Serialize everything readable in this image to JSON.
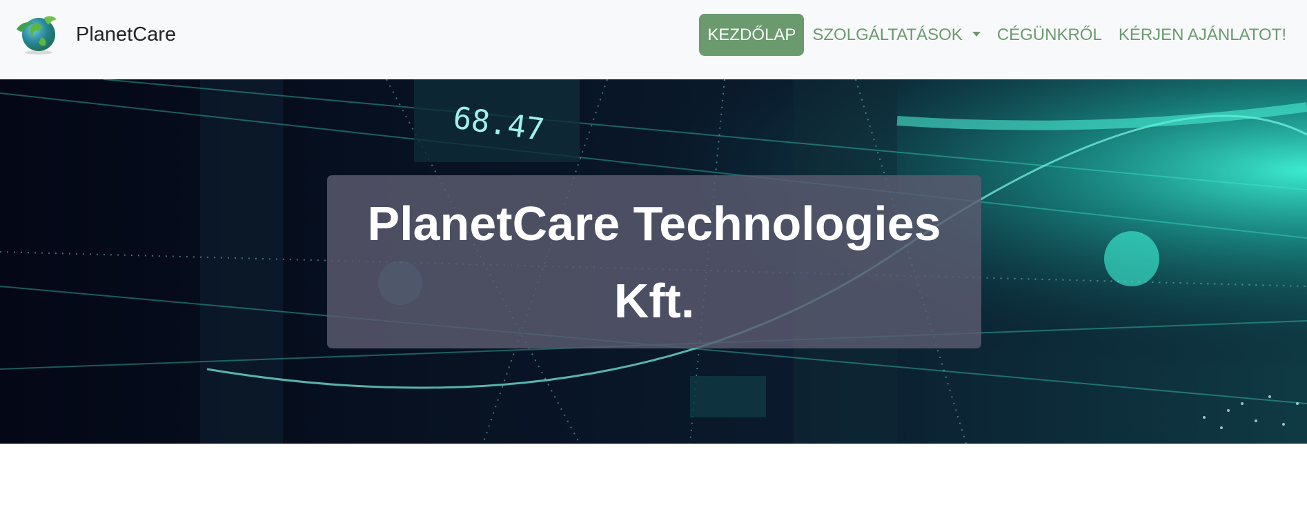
{
  "brand": {
    "name": "PlanetCare",
    "logo_icon": "globe-leaf-icon"
  },
  "nav": {
    "items": [
      {
        "label": "KEZDŐLAP",
        "active": true
      },
      {
        "label": "SZOLGÁLTATÁSOK",
        "dropdown": true
      },
      {
        "label": "CÉGÜNKRŐL"
      },
      {
        "label": "KÉRJEN AJÁNLATOT!"
      }
    ]
  },
  "hero": {
    "title": "PlanetCare Technologies Kft.",
    "background_readouts": [
      "68.47"
    ]
  },
  "colors": {
    "accent": "#6a9a6e",
    "navbar_bg": "#f8f9fa",
    "hero_bg": "#050a1c",
    "glow": "#3ff5d8"
  }
}
